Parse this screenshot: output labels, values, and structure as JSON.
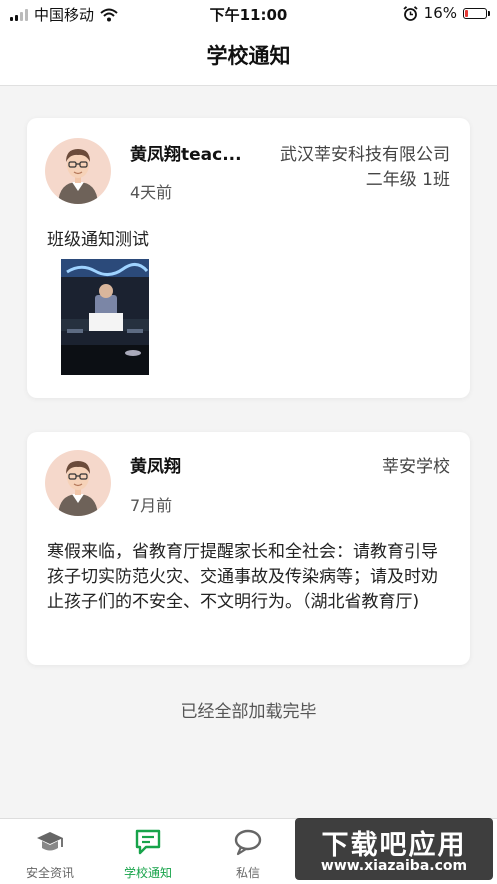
{
  "status_bar": {
    "carrier": "中国移动",
    "time": "下午11:00",
    "battery_percent": "16%",
    "battery_level": 0.16,
    "signal_bars_active": 2,
    "battery_color": "#e53935"
  },
  "header": {
    "title": "学校通知"
  },
  "notices": [
    {
      "author": "黄凤翔teac...",
      "organization": "武汉莘安科技有限公司",
      "class_name": "二年级 1班",
      "time": "4天前",
      "content": "班级通知测试",
      "has_image": true
    },
    {
      "author": "黄凤翔",
      "organization": "莘安学校",
      "time": "7月前",
      "content": "寒假来临，省教育厅提醒家长和全社会：请教育引导孩子切实防范火灾、交通事故及传染病等；请及时劝止孩子们的不安全、不文明行为。（湖北省教育厅)",
      "has_image": false
    }
  ],
  "load_status": "已经全部加载完毕",
  "tab_bar": {
    "tabs": [
      {
        "label": "安全资讯",
        "icon": "graduation-cap-icon",
        "active": false
      },
      {
        "label": "学校通知",
        "icon": "chat-notice-icon",
        "active": true
      },
      {
        "label": "私信",
        "icon": "message-bubble-icon",
        "active": false
      }
    ],
    "accent_color": "#17a34a"
  },
  "watermark": {
    "title": "下载吧应用",
    "url": "www.xiazaiba.com"
  }
}
